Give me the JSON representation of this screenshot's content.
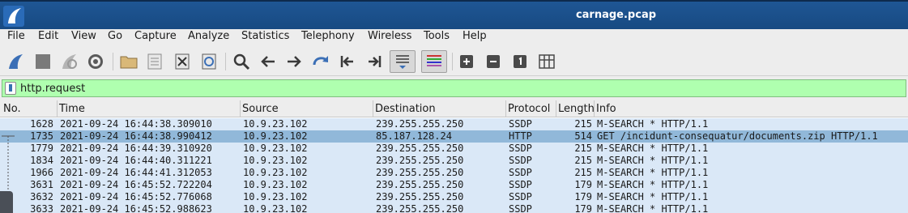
{
  "window": {
    "title": "carnage.pcap"
  },
  "menu": [
    "File",
    "Edit",
    "View",
    "Go",
    "Capture",
    "Analyze",
    "Statistics",
    "Telephony",
    "Wireless",
    "Tools",
    "Help"
  ],
  "toolbar": {
    "icons": [
      "shark-fin-start-icon",
      "stop-capture-icon",
      "restart-capture-icon",
      "capture-options-icon",
      "open-file-icon",
      "save-file-icon",
      "close-file-icon",
      "reload-file-icon",
      "find-packet-icon",
      "go-back-icon",
      "go-forward-icon",
      "go-to-packet-icon",
      "first-packet-icon",
      "last-packet-icon",
      "auto-scroll-icon",
      "colorize-icon",
      "zoom-in-icon",
      "zoom-out-icon",
      "normal-size-icon",
      "resize-columns-icon"
    ]
  },
  "filter": {
    "value": "http.request"
  },
  "columns": [
    "No.",
    "Time",
    "Source",
    "Destination",
    "Protocol",
    "Length",
    "Info"
  ],
  "rows": [
    {
      "no": "1628",
      "time": "2021-09-24 16:44:38.309010",
      "src": "10.9.23.102",
      "dst": "239.255.255.250",
      "proto": "SSDP",
      "len": "215",
      "info": "M-SEARCH * HTTP/1.1",
      "selected": false
    },
    {
      "no": "1735",
      "time": "2021-09-24 16:44:38.990412",
      "src": "10.9.23.102",
      "dst": "85.187.128.24",
      "proto": "HTTP",
      "len": "514",
      "info": "GET /incidunt-consequatur/documents.zip HTTP/1.1",
      "selected": true
    },
    {
      "no": "1779",
      "time": "2021-09-24 16:44:39.310920",
      "src": "10.9.23.102",
      "dst": "239.255.255.250",
      "proto": "SSDP",
      "len": "215",
      "info": "M-SEARCH * HTTP/1.1",
      "selected": false
    },
    {
      "no": "1834",
      "time": "2021-09-24 16:44:40.311221",
      "src": "10.9.23.102",
      "dst": "239.255.255.250",
      "proto": "SSDP",
      "len": "215",
      "info": "M-SEARCH * HTTP/1.1",
      "selected": false
    },
    {
      "no": "1966",
      "time": "2021-09-24 16:44:41.312053",
      "src": "10.9.23.102",
      "dst": "239.255.255.250",
      "proto": "SSDP",
      "len": "215",
      "info": "M-SEARCH * HTTP/1.1",
      "selected": false
    },
    {
      "no": "3631",
      "time": "2021-09-24 16:45:52.722204",
      "src": "10.9.23.102",
      "dst": "239.255.255.250",
      "proto": "SSDP",
      "len": "179",
      "info": "M-SEARCH * HTTP/1.1",
      "selected": false
    },
    {
      "no": "3632",
      "time": "2021-09-24 16:45:52.776068",
      "src": "10.9.23.102",
      "dst": "239.255.255.250",
      "proto": "SSDP",
      "len": "179",
      "info": "M-SEARCH * HTTP/1.1",
      "selected": false
    },
    {
      "no": "3633",
      "time": "2021-09-24 16:45:52.988623",
      "src": "10.9.23.102",
      "dst": "239.255.255.250",
      "proto": "SSDP",
      "len": "179",
      "info": "M-SEARCH * HTTP/1.1",
      "selected": false
    }
  ],
  "colors": {
    "title_bg": "#1f5694",
    "filter_bg": "#afffaf",
    "row_bg": "#dae8f7",
    "row_selected": "#91b8d9"
  }
}
